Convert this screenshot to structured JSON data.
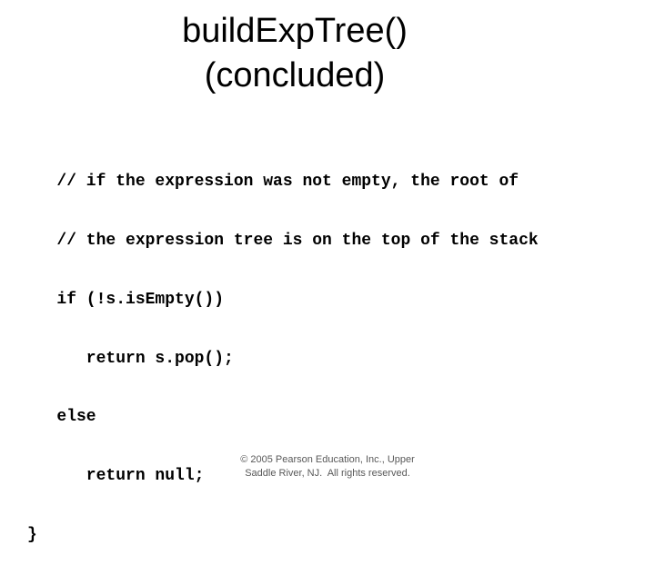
{
  "title": {
    "line1": "buildExpTree()",
    "line2": "(concluded)"
  },
  "code": {
    "lines": [
      "   // if the expression was not empty, the root of",
      "   // the expression tree is on the top of the stack",
      "   if (!s.isEmpty())",
      "      return s.pop();",
      "   else",
      "      return null;",
      "}"
    ]
  },
  "footer": {
    "line1": "© 2005 Pearson Education, Inc., Upper",
    "line2": "Saddle River, NJ.  All rights reserved."
  }
}
